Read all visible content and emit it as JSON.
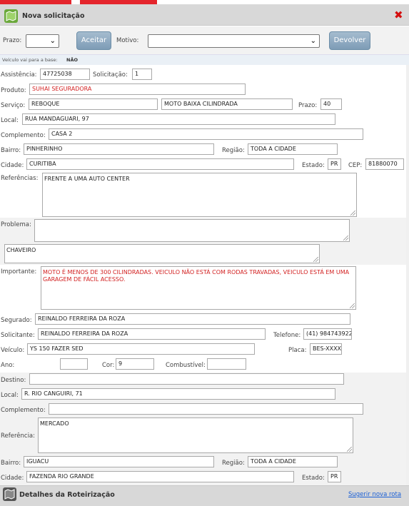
{
  "header": {
    "title": "Nova solicitação",
    "close_icon": "close-x-icon"
  },
  "toolbar": {
    "prazo_label": "Prazo:",
    "aceitar_label": "Aceitar",
    "motivo_label": "Motivo:",
    "devolver_label": "Devolver"
  },
  "info": {
    "base_label": "Veículo vai para a base:",
    "base_value": "NÃO"
  },
  "form": {
    "assistencia_label": "Assistência:",
    "assistencia": "47725038",
    "solicitacao_label": "Solicitação:",
    "solicitacao": "1",
    "produto_label": "Produto:",
    "produto": "SUHAI SEGURADORA",
    "servico_label": "Serviço:",
    "servico": "REBOQUE",
    "servico_tipo": "MOTO BAIXA CILINDRADA",
    "prazo_label": "Prazo:",
    "prazo": "40",
    "local_label": "Local:",
    "local": "RUA MANDAGUARI, 97",
    "complemento_label": "Complemento:",
    "complemento": "CASA 2",
    "bairro_label": "Bairro:",
    "bairro": "PINHERINHO",
    "regiao_label": "Região:",
    "regiao": "TODA A CIDADE",
    "cidade_label": "Cidade:",
    "cidade": "CURITIBA",
    "estado_label": "Estado:",
    "estado": "PR",
    "cep_label": "CEP:",
    "cep": "81880070",
    "referencias_label": "Referências:",
    "referencias": "FRENTE A UMA AUTO CENTER",
    "problema_label": "Problema:",
    "problema": "",
    "problema2": "CHAVEIRO",
    "importante_label": "Importante:",
    "importante": "MOTO É MENOS DE 300 CILINDRADAS. VEICULO NÃO ESTÁ COM RODAS TRAVADAS, VEICULO ESTÁ EM UMA GARAGEM DE FÁCIL ACESSO.",
    "segurado_label": "Segurado:",
    "segurado": "REINALDO FERREIRA DA ROZA",
    "solicitante_label": "Solicitante:",
    "solicitante": "REINALDO FERREIRA DA ROZA",
    "telefone_label": "Telefone:",
    "telefone": "(41) 984743922",
    "veiculo_label": "Veículo:",
    "veiculo": "YS 150 FAZER SED",
    "placa_label": "Placa:",
    "placa": "BES-XXXX",
    "ano_label": "Ano:",
    "ano": "",
    "cor_label": "Cor:",
    "cor": "9",
    "combustivel_label": "Combustível:",
    "combustivel": ""
  },
  "destino": {
    "destino_label": "Destino:",
    "destino": "",
    "local_label": "Local:",
    "local": "R. RIO CANGUIRI, 71",
    "complemento_label": "Complemento:",
    "complemento": "",
    "referencia_label": "Referência:",
    "referencia": "MERCADO",
    "bairro_label": "Bairro:",
    "bairro": "IGUACU",
    "regiao_label": "Região:",
    "regiao": "TODA A CIDADE",
    "cidade_label": "Cidade:",
    "cidade": "FAZENDA RIO GRANDE",
    "estado_label": "Estado:",
    "estado": "PR"
  },
  "footer": {
    "title": "Detalhes da Roteirização",
    "link": "Sugerir nova rota"
  }
}
